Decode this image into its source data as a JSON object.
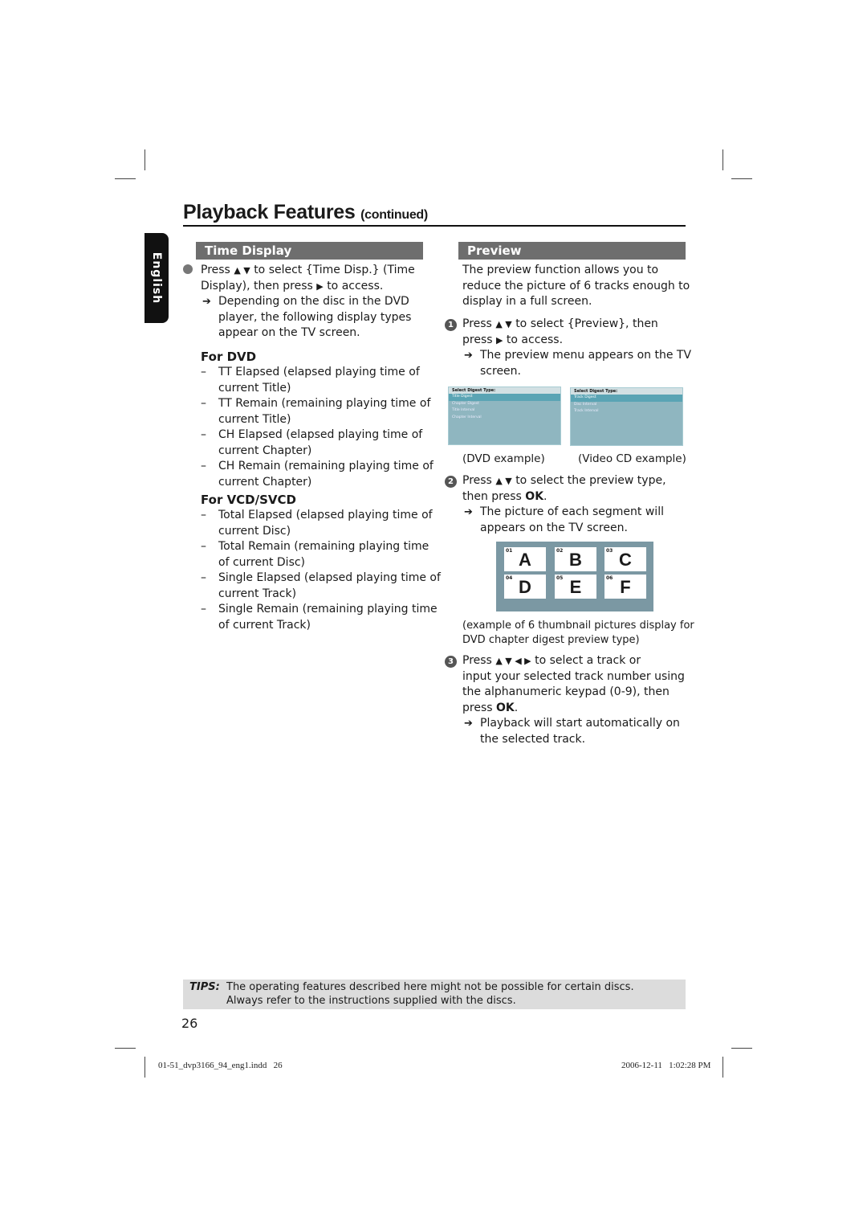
{
  "page": {
    "title": "Playback Features",
    "title_suffix": "(continued)",
    "language_tab": "English",
    "page_number": "26"
  },
  "time_display": {
    "heading": "Time Display",
    "step_line1": [
      "Press",
      "▲ ▼",
      "to select {Time Disp.} (Time"
    ],
    "step_line2": [
      "Display), then press",
      "▶",
      "to access."
    ],
    "result_lines": [
      "Depending on the disc in the DVD",
      "player, the following display types",
      "appear on the TV screen."
    ],
    "dvd": {
      "heading": "For DVD",
      "items": [
        [
          "TT Elapsed (elapsed playing time of",
          "current Title)"
        ],
        [
          "TT Remain (remaining playing time of",
          "current Title)"
        ],
        [
          "CH Elapsed (elapsed playing time of",
          "current Chapter)"
        ],
        [
          "CH Remain (remaining playing time of",
          "current Chapter)"
        ]
      ]
    },
    "vcd": {
      "heading": "For VCD/SVCD",
      "items": [
        [
          "Total Elapsed (elapsed playing time of",
          "current Disc)"
        ],
        [
          "Total Remain (remaining playing time",
          "of current Disc)"
        ],
        [
          "Single Elapsed (elapsed playing time of",
          "current Track)"
        ],
        [
          "Single Remain (remaining playing time",
          "of current Track)"
        ]
      ]
    }
  },
  "preview": {
    "heading": "Preview",
    "intro": [
      "The preview function allows you to",
      "reduce the picture of 6 tracks enough to",
      "display in a full screen."
    ],
    "step1": {
      "num": "1",
      "line1": [
        "Press",
        "▲ ▼",
        "to select {Preview}, then"
      ],
      "line2": [
        "press",
        "▶",
        "to access."
      ],
      "result": [
        "The preview menu appears on the TV",
        "screen."
      ]
    },
    "dvd_menu": {
      "title": "Select Digest Type:",
      "items": [
        "Title Digest",
        "Chapter Digest",
        "Title Interval",
        "Chapter Interval"
      ],
      "selected": 0,
      "caption": "(DVD example)"
    },
    "vcd_menu": {
      "title": "Select Digest Type:",
      "items": [
        "Track Digest",
        "Disc Interval",
        "Track Interval"
      ],
      "selected": 0,
      "caption": "(Video CD example)"
    },
    "step2": {
      "num": "2",
      "line1": [
        "Press",
        "▲ ▼",
        "to select the preview type,"
      ],
      "line2": [
        "then press",
        "OK",
        "."
      ],
      "result": [
        "The picture of each segment will",
        "appears on the TV screen."
      ]
    },
    "thumbnails": [
      {
        "num": "01",
        "letter": "A"
      },
      {
        "num": "02",
        "letter": "B"
      },
      {
        "num": "03",
        "letter": "C"
      },
      {
        "num": "04",
        "letter": "D"
      },
      {
        "num": "05",
        "letter": "E"
      },
      {
        "num": "06",
        "letter": "F"
      }
    ],
    "thumb_caption": [
      "(example of 6 thumbnail pictures display for",
      "DVD chapter digest preview type)"
    ],
    "step3": {
      "num": "3",
      "line1": [
        "Press",
        "▲ ▼ ◀ ▶",
        "to select a track or"
      ],
      "line2": "input your selected track number using",
      "line3": "the alphanumeric keypad (0-9), then",
      "line4": [
        "press",
        "OK",
        "."
      ],
      "result": [
        "Playback will start automatically on",
        "the selected track."
      ]
    }
  },
  "tips": {
    "label": "TIPS:",
    "lines": [
      "The operating features described here might not be possible for certain discs.",
      "Always refer to the instructions supplied with the discs."
    ]
  },
  "footer": {
    "file": "01-51_dvp3166_94_eng1.indd   26",
    "timestamp": "2006-12-11   1:02:28 PM"
  },
  "colors": {
    "section_header": "#6e6e6e",
    "menu_bg": "#8fb6c0",
    "menu_selected": "#5aa4b4",
    "thumb_bg": "#7b98a3",
    "tips_bg": "#dcdcdc"
  }
}
